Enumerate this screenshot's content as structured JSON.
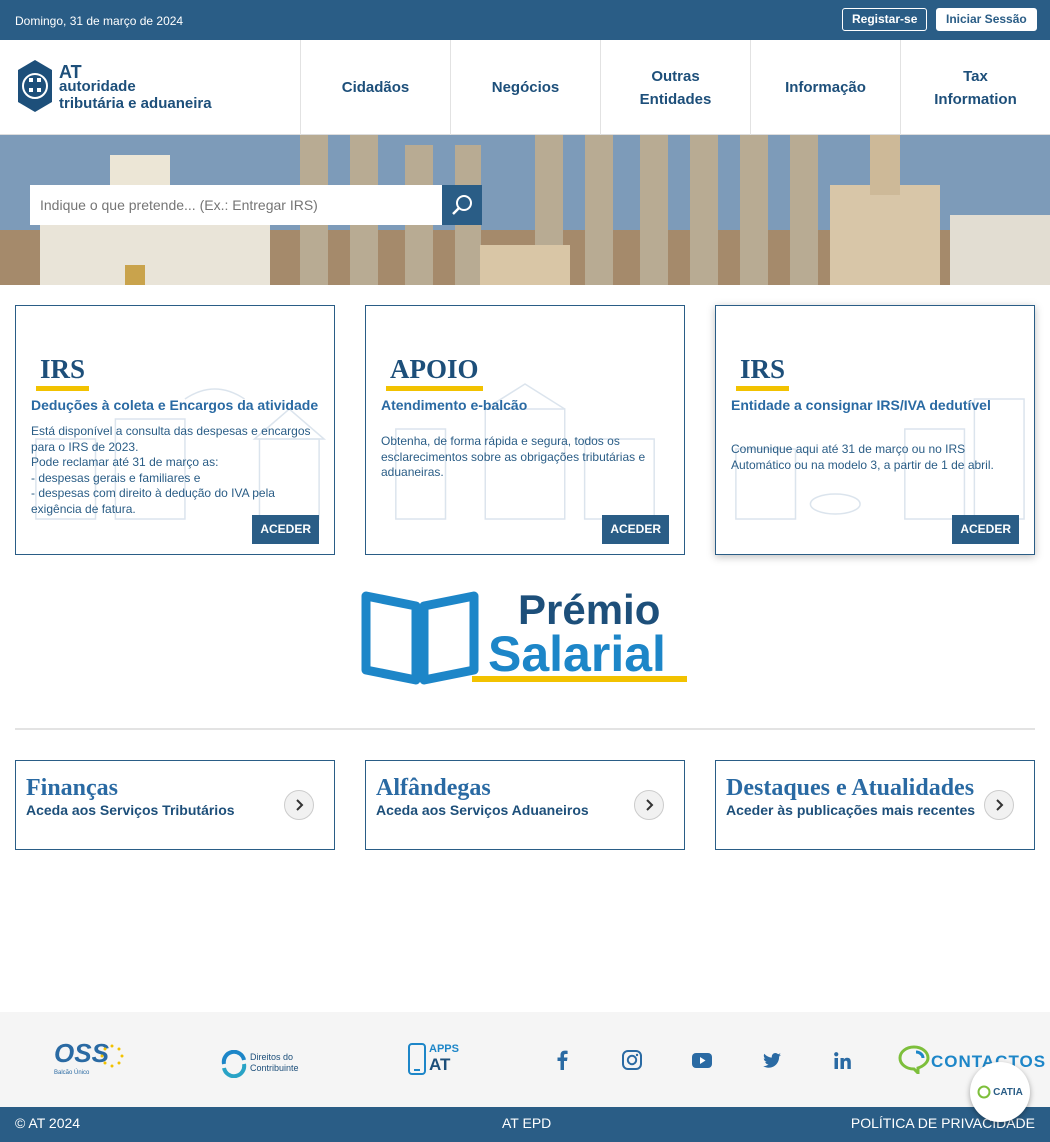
{
  "topbar": {
    "date": "Domingo, 31 de março de 2024",
    "register_label": "Registar-se",
    "login_label": "Iniciar Sessão"
  },
  "logo": {
    "line1": "AT",
    "line2": "autoridade",
    "line3": "tributária e aduaneira"
  },
  "nav": {
    "items": [
      {
        "label": "Cidadãos"
      },
      {
        "label": "Negócios"
      },
      {
        "label": "Outras Entidades"
      },
      {
        "label": "Informação"
      },
      {
        "label": "Tax Information"
      }
    ]
  },
  "search": {
    "placeholder": "Indique o que pretende... (Ex.: Entregar IRS)"
  },
  "cards": [
    {
      "tag": "IRS",
      "subtitle": "Deduções à coleta e Encargos da atividade",
      "description": "Está disponível a consulta das despesas e encargos para o IRS de 2023.\nPode reclamar até 31 de março as:\n- despesas gerais e familiares e\n- despesas com direito à dedução do IVA pela exigência de fatura.",
      "button": "ACEDER"
    },
    {
      "tag": "APOIO",
      "subtitle": "Atendimento e-balcão",
      "description": "Obtenha, de forma rápida e segura, todos os esclarecimentos sobre as obrigações tributárias e aduaneiras.",
      "button": "ACEDER"
    },
    {
      "tag": "IRS",
      "subtitle": "Entidade a consignar IRS/IVA dedutível",
      "description": "Comunique aqui até 31 de março ou no IRS Automático ou na modelo 3, a partir de 1 de abril.",
      "button": "ACEDER"
    }
  ],
  "banner": {
    "line1": "Prémio",
    "line2": "Salarial"
  },
  "services": [
    {
      "title": "Finanças",
      "subtitle": "Aceda aos Serviços Tributários"
    },
    {
      "title": "Alfândegas",
      "subtitle": "Aceda aos Serviços Aduaneiros"
    },
    {
      "title": "Destaques e Atualidades",
      "subtitle": "Aceder às publicações mais recentes"
    }
  ],
  "footer_links": {
    "oss": "OSS",
    "oss_sub": "Balcão Único",
    "rights_line1": "Direitos do",
    "rights_line2": "Contribuinte",
    "apps_line1": "APPS",
    "apps_line2": "AT",
    "contacts": "CONTACTOS"
  },
  "footer": {
    "copyright": "© AT 2024",
    "epd": "AT EPD",
    "privacy": "POLÍTICA DE PRIVACIDADE"
  },
  "chat": {
    "label": "CATIA"
  },
  "colors": {
    "primary": "#2a5d86",
    "accent_yellow": "#f2c200",
    "link_blue": "#2a6aa3"
  }
}
